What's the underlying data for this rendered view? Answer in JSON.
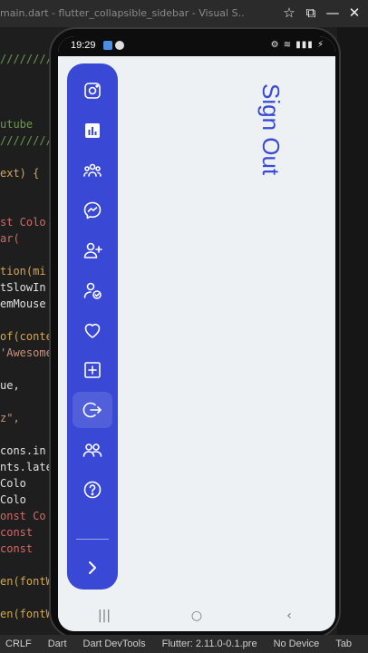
{
  "window": {
    "title": "main.dart - flutter_collapsible_sidebar - Visual S...",
    "icons": [
      "pin-icon",
      "restore-icon",
      "minimize-icon",
      "close-icon"
    ]
  },
  "editor": {
    "lines": [
      {
        "text": "////////////",
        "color": "#6a9955"
      },
      {
        "text": "utube",
        "color": "#6a9955"
      },
      {
        "text": "////////////",
        "color": "#6a9955"
      },
      {
        "text": "ext) {",
        "color": "#d4a84c"
      },
      {
        "text": "st Colo",
        "color": "#d16969"
      },
      {
        "text": "ar(",
        "color": "#d16969"
      },
      {
        "text": "tion(mi",
        "color": "#d4a84c"
      },
      {
        "text": "tSlowIn",
        "color": "#e0e0e0"
      },
      {
        "text": "emMouse",
        "color": "#e0e0e0"
      },
      {
        "text": "of(conte",
        "color": "#d4a84c"
      },
      {
        "text": "'Awesome",
        "color": "#ce9178"
      },
      {
        "text": "ue,",
        "color": "#e0e0e0"
      },
      {
        "text": "z\",",
        "color": "#ce9178"
      },
      {
        "text": "cons.in",
        "color": "#e0e0e0"
      },
      {
        "text": "nts.late",
        "color": "#e0e0e0"
      },
      {
        "text": "  Colo",
        "color": "#e0e0e0"
      },
      {
        "text": "  Colo",
        "color": "#e0e0e0"
      },
      {
        "text": "onst Co",
        "color": "#d16969"
      },
      {
        "text": " const",
        "color": "#d16969"
      },
      {
        "text": " const",
        "color": "#d16969"
      },
      {
        "text": "en(fontW",
        "color": "#d4a84c"
      },
      {
        "text": "en(fontWe",
        "color": "#d4a84c"
      }
    ]
  },
  "statusbar": {
    "items": [
      "CRLF",
      "Dart",
      "Dart DevTools",
      "Flutter: 2.11.0-0.1.pre",
      "No Device",
      "Tab"
    ]
  },
  "phone": {
    "time": "19:29",
    "status_right": "⚙ ≋ ▮▮▮ ⚡"
  },
  "app": {
    "accent": "#3949d6",
    "background": "#eef1f4",
    "page_title": "Sign Out",
    "nav_items": [
      {
        "icon": "instagram-icon"
      },
      {
        "icon": "chart-icon"
      },
      {
        "icon": "group-icon"
      },
      {
        "icon": "messenger-icon"
      },
      {
        "icon": "add-user-icon"
      },
      {
        "icon": "user-check-icon"
      },
      {
        "icon": "heart-icon"
      },
      {
        "icon": "add-box-icon"
      },
      {
        "icon": "sign-out-icon",
        "active": true
      },
      {
        "icon": "people-icon"
      },
      {
        "icon": "help-icon"
      }
    ],
    "toggle_icon": "chevron-right-icon"
  },
  "android_nav": {
    "recents": "|||",
    "home": "○",
    "back": "‹"
  }
}
